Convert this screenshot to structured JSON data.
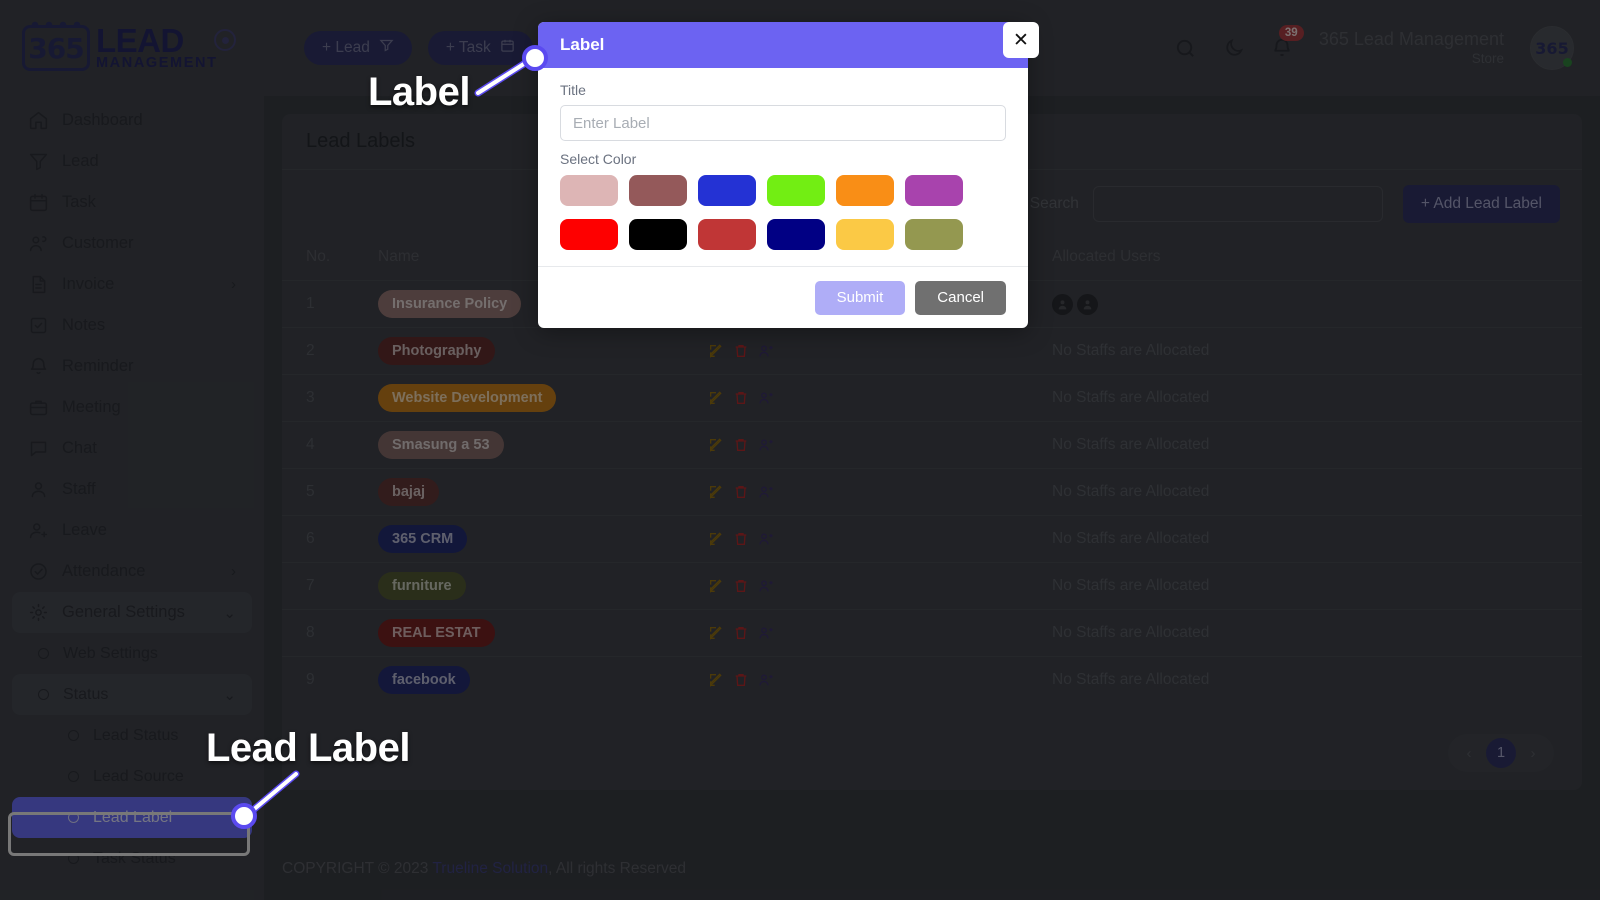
{
  "brand": {
    "logo_365": "365",
    "logo_lead": "LEAD",
    "logo_mgmt": "MANAGEMENT"
  },
  "sidebar": {
    "items": [
      {
        "label": "Dashboard",
        "icon": "home-icon",
        "level": 0,
        "chevron": ""
      },
      {
        "label": "Lead",
        "icon": "funnel-icon",
        "level": 0,
        "chevron": ""
      },
      {
        "label": "Task",
        "icon": "calendar-icon",
        "level": 0,
        "chevron": ""
      },
      {
        "label": "Customer",
        "icon": "users-icon",
        "level": 0,
        "chevron": ""
      },
      {
        "label": "Invoice",
        "icon": "file-text-icon",
        "level": 0,
        "chevron": "›"
      },
      {
        "label": "Notes",
        "icon": "note-check-icon",
        "level": 0,
        "chevron": ""
      },
      {
        "label": "Reminder",
        "icon": "bell-icon",
        "level": 0,
        "chevron": ""
      },
      {
        "label": "Meeting",
        "icon": "briefcase-icon",
        "level": 0,
        "chevron": ""
      },
      {
        "label": "Chat",
        "icon": "chat-bubble-icon",
        "level": 0,
        "chevron": ""
      },
      {
        "label": "Staff",
        "icon": "user-icon",
        "level": 0,
        "chevron": ""
      },
      {
        "label": "Leave",
        "icon": "user-minus-icon",
        "level": 0,
        "chevron": ""
      },
      {
        "label": "Attendance",
        "icon": "check-circle-icon",
        "level": 0,
        "chevron": "›"
      },
      {
        "label": "General Settings",
        "icon": "gear-icon",
        "level": 0,
        "chevron": "⌄",
        "group": true
      },
      {
        "label": "Web Settings",
        "icon": "circle-dot-icon",
        "level": 1,
        "chevron": ""
      },
      {
        "label": "Status",
        "icon": "circle-dot-icon",
        "level": 1,
        "chevron": "⌄",
        "group": true
      },
      {
        "label": "Lead Status",
        "icon": "circle-dot-icon",
        "level": 2,
        "chevron": ""
      },
      {
        "label": "Lead Source",
        "icon": "circle-dot-icon",
        "level": 2,
        "chevron": ""
      },
      {
        "label": "Lead Label",
        "icon": "circle-dot-icon",
        "level": 2,
        "chevron": "",
        "active": true
      },
      {
        "label": "Task Status",
        "icon": "circle-dot-icon",
        "level": 2,
        "chevron": ""
      }
    ]
  },
  "topbar": {
    "lead_button": "+ Lead",
    "task_button": "+ Task",
    "notification_count": "39",
    "account_name": "365 Lead Management",
    "account_role": "Store",
    "avatar_text": "365"
  },
  "page": {
    "card_title": "Lead Labels",
    "search_label": "Search",
    "search_value": "",
    "add_button": "+ Add Lead Label",
    "columns": [
      "No.",
      "Name",
      "",
      "Allocated Users"
    ],
    "rows": [
      {
        "no": "1",
        "name": "Insurance Policy",
        "color": "#8d6f6d",
        "allocated": "",
        "has_avatars": true
      },
      {
        "no": "2",
        "name": "Photography",
        "color": "#5b2b2b",
        "allocated": "No Staffs are Allocated",
        "has_avatars": false
      },
      {
        "no": "3",
        "name": "Website Development",
        "color": "#b8761a",
        "allocated": "No Staffs are Allocated",
        "has_avatars": false
      },
      {
        "no": "4",
        "name": "Smasung a 53",
        "color": "#7d6361",
        "allocated": "No Staffs are Allocated",
        "has_avatars": false
      },
      {
        "no": "5",
        "name": "bajaj",
        "color": "#5c3434",
        "allocated": "No Staffs are Allocated",
        "has_avatars": false
      },
      {
        "no": "6",
        "name": "365 CRM",
        "color": "#222a6b",
        "allocated": "No Staffs are Allocated",
        "has_avatars": false
      },
      {
        "no": "7",
        "name": "furniture",
        "color": "#4e5431",
        "allocated": "No Staffs are Allocated",
        "has_avatars": false
      },
      {
        "no": "8",
        "name": "REAL ESTAT",
        "color": "#6e1f20",
        "allocated": "No Staffs are Allocated",
        "has_avatars": false
      },
      {
        "no": "9",
        "name": "facebook",
        "color": "#232a6a",
        "allocated": "No Staffs are Allocated",
        "has_avatars": false
      }
    ],
    "row_actions": [
      "edit-icon",
      "delete-icon",
      "assign-user-icon"
    ],
    "pagination": {
      "prev": "‹",
      "current": "1",
      "next": "›"
    },
    "footer_prefix": "COPYRIGHT © 2023 ",
    "footer_link": "Trueline Solution",
    "footer_suffix": ", All rights Reserved"
  },
  "modal": {
    "title": "Label",
    "close_icon": "✕",
    "title_field_label": "Title",
    "title_field_value": "",
    "title_field_placeholder": "Enter Label",
    "select_color_label": "Select Color",
    "colors": [
      "#ddb5b5",
      "#94595a",
      "#2432d4",
      "#72ee13",
      "#f98e16",
      "#a843ad",
      "#fe0000",
      "#000000",
      "#c03636",
      "#010084",
      "#fbc945",
      "#949850"
    ],
    "submit_label": "Submit",
    "cancel_label": "Cancel",
    "header_color": "#6c63f2",
    "submit_color": "#afadf7",
    "cancel_color": "#707070"
  },
  "annotations": [
    {
      "id": "anno-label",
      "text": "Label"
    },
    {
      "id": "anno-leadlabel",
      "text": "Lead Label"
    }
  ]
}
